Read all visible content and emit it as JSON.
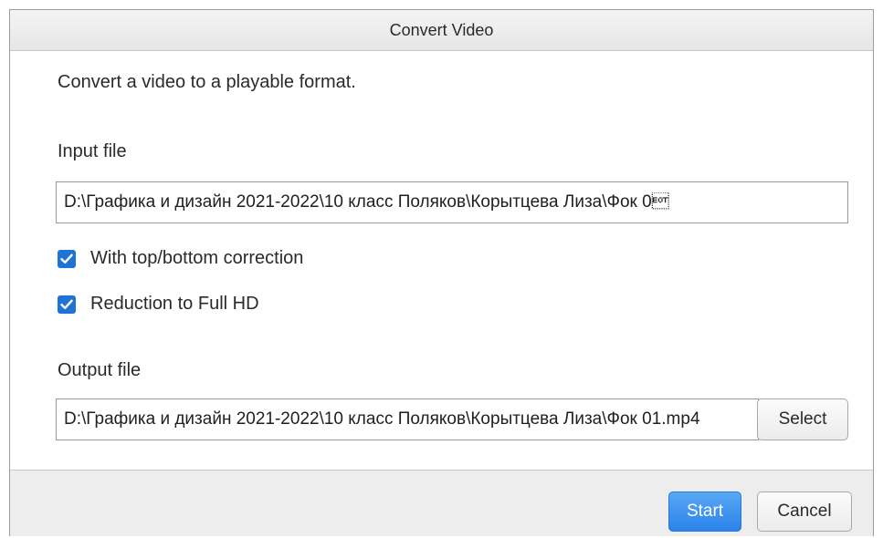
{
  "dialog": {
    "title": "Convert Video",
    "description": "Convert a video to a playable format."
  },
  "input": {
    "label": "Input file",
    "value": "D:\\Графика и дизайн 2021-2022\\10 класс Поляков\\Корытцева Лиза\\Фок 0\u0004"
  },
  "options": [
    {
      "label": "With top/bottom correction",
      "checked": true
    },
    {
      "label": "Reduction to Full HD",
      "checked": true
    }
  ],
  "output": {
    "label": "Output file",
    "value": "D:\\Графика и дизайн 2021-2022\\10 класс Поляков\\Корытцева Лиза\\Фок 01.mp4",
    "select_label": "Select"
  },
  "footer": {
    "start_label": "Start",
    "cancel_label": "Cancel"
  },
  "colors": {
    "accent": "#2b82ea",
    "checkbox": "#1f73d4"
  }
}
